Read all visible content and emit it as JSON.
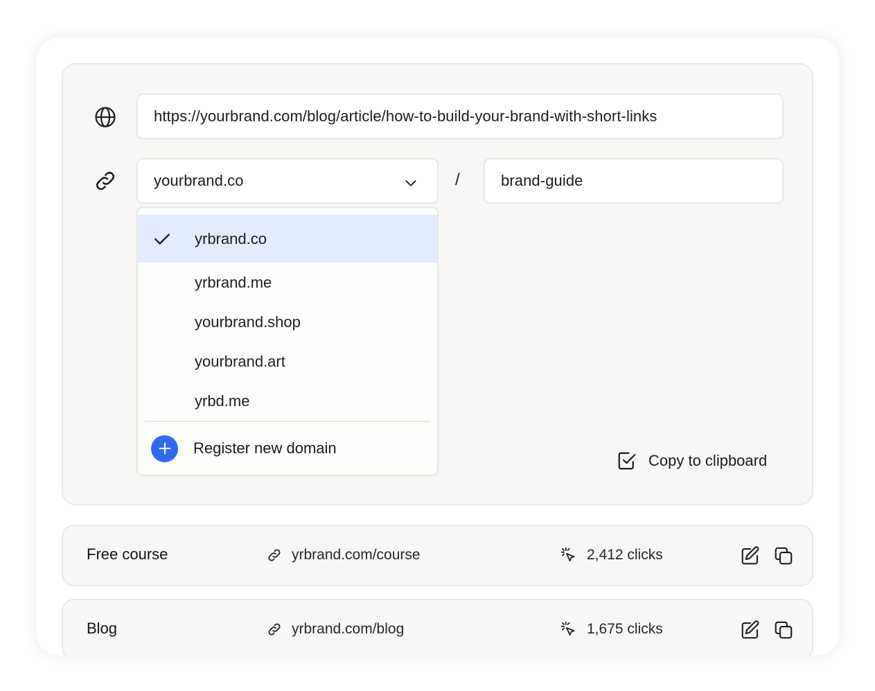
{
  "long_url": {
    "value": "https://yourbrand.com/blog/article/how-to-build-your-brand-with-short-links",
    "icon": "globe-icon"
  },
  "short_link": {
    "icon": "link-icon",
    "domain_value": "yourbrand.co",
    "separator": "/",
    "slug_value": "brand-guide"
  },
  "dropdown": {
    "options": [
      {
        "label": "yrbrand.co",
        "selected": true
      },
      {
        "label": "yrbrand.me",
        "selected": false
      },
      {
        "label": "yourbrand.shop",
        "selected": false
      },
      {
        "label": "yourbrand.art",
        "selected": false
      },
      {
        "label": "yrbd.me",
        "selected": false
      }
    ],
    "register_label": "Register new domain"
  },
  "copy_label": "Copy to clipboard",
  "links": [
    {
      "title": "Free course",
      "url": "yrbrand.com/course",
      "clicks": "2,412 clicks"
    },
    {
      "title": "Blog",
      "url": "yrbrand.com/blog",
      "clicks": "1,675 clicks"
    }
  ],
  "colors": {
    "accent": "#2e6bf0",
    "selected_bg": "#e3ecfd",
    "panel_bg": "#f8f7f6"
  }
}
